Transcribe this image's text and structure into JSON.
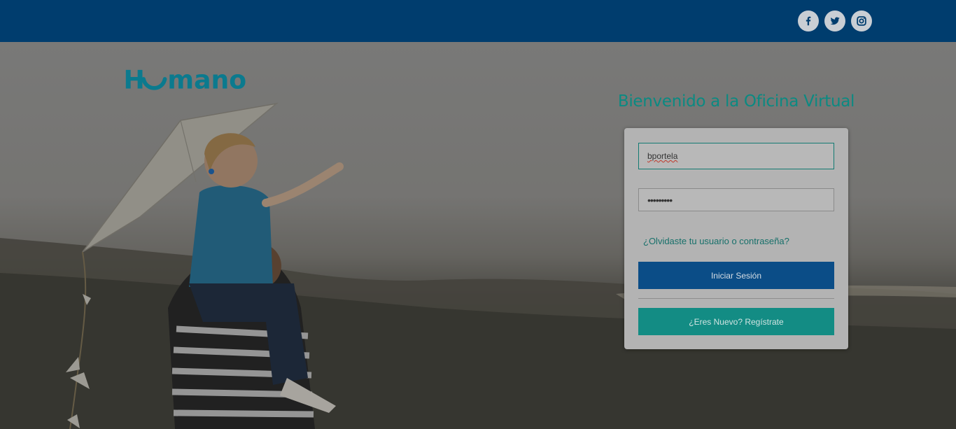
{
  "header": {
    "social": [
      {
        "name": "facebook",
        "icon": "facebook-icon"
      },
      {
        "name": "twitter",
        "icon": "twitter-icon"
      },
      {
        "name": "instagram",
        "icon": "instagram-icon"
      }
    ]
  },
  "brand": {
    "logo_text": "Humano",
    "color": "#0b7a8e"
  },
  "login": {
    "welcome_title": "Bienvenido a la Oficina Virtual",
    "username_value": "bportela",
    "password_value": "•••••••••",
    "forgot_link": "¿Olvidaste tu usuario o contraseña?",
    "login_button": "Iniciar Sesión",
    "register_button": "¿Eres Nuevo? Regístrate"
  },
  "colors": {
    "topbar": "#003d6e",
    "accent_teal": "#138c84",
    "primary_blue": "#0b4d87"
  }
}
